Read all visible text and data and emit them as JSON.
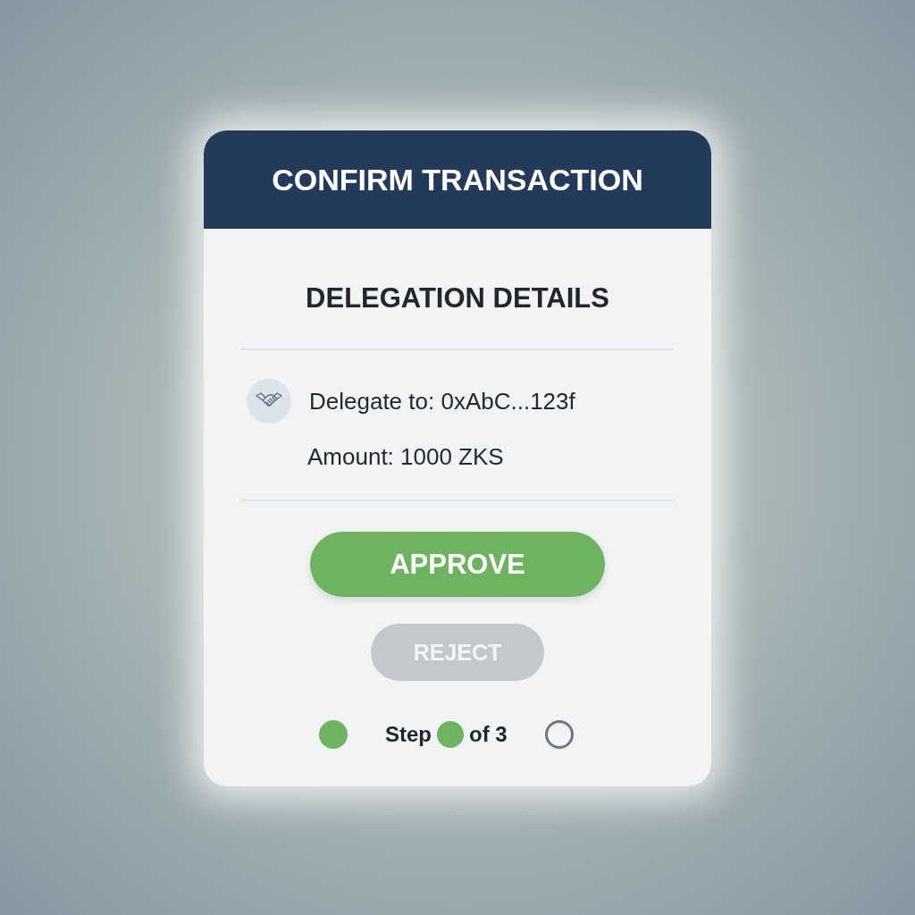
{
  "dialog": {
    "title": "CONFIRM TRANSACTION",
    "heading": "DELEGATION DETAILS",
    "details": [
      {
        "kind": "delegate",
        "text": "Delegate to: 0xAbC...123f"
      },
      {
        "kind": "amount",
        "text": "Amount: 1000 ZKS"
      }
    ],
    "buttons": [
      {
        "kind": "primary",
        "label": "APPROVE"
      },
      {
        "kind": "secondary",
        "label": "REJECT"
      }
    ],
    "progress": {
      "step_word": "Step",
      "total_text": "of 3",
      "steps": [
        {
          "done": true
        },
        {
          "done": true
        },
        {
          "done": false
        }
      ]
    }
  }
}
